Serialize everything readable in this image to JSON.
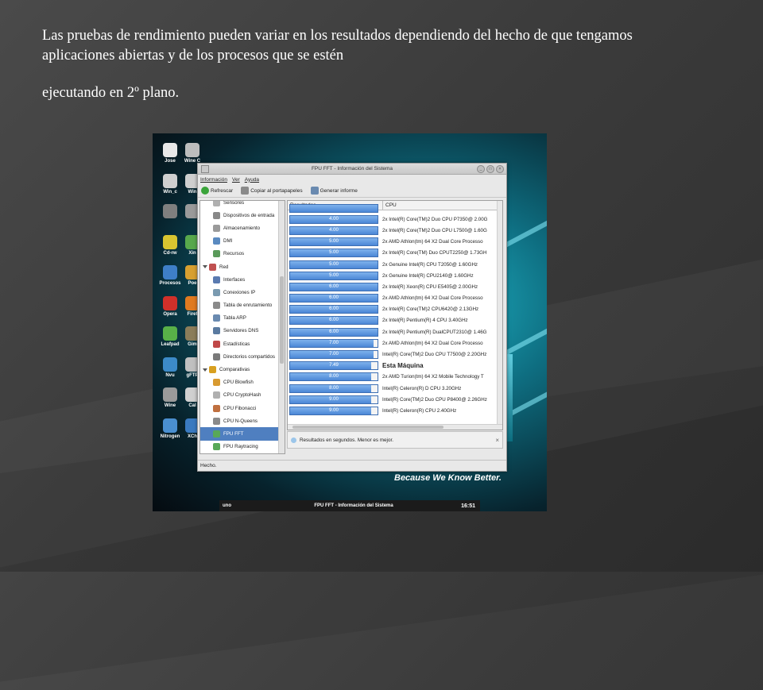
{
  "slide": {
    "paragraph1": "Las pruebas de rendimiento  pueden variar en los resultados dependiendo  del hecho de que tengamos aplicaciones abiertas y de los procesos que se estén",
    "paragraph2": "ejecutando  en 2º plano."
  },
  "desktop": {
    "icons": [
      {
        "label": "Jose",
        "color": "#e8e8e8"
      },
      {
        "label": "Wine C",
        "color": "#bdbdbd"
      },
      {
        "label": "Win_c",
        "color": "#cfcfcf"
      },
      {
        "label": "Win",
        "color": "#cfcfcf"
      },
      {
        "label": "",
        "color": "#7f7f7f"
      },
      {
        "label": "",
        "color": "#9a9a9a"
      },
      {
        "label": "Cd-rw",
        "color": "#d9c530"
      },
      {
        "label": "Xin",
        "color": "#58a84c"
      },
      {
        "label": "Procesos",
        "color": "#3e7fc7"
      },
      {
        "label": "Poe",
        "color": "#d8a030"
      },
      {
        "label": "Opera",
        "color": "#d0302a"
      },
      {
        "label": "Firef",
        "color": "#e07a20"
      },
      {
        "label": "Leafpad",
        "color": "#58b048"
      },
      {
        "label": "Gim",
        "color": "#8b7d5a"
      },
      {
        "label": "Nvu",
        "color": "#3c8ac8"
      },
      {
        "label": "gFTP",
        "color": "#c0c0c0"
      },
      {
        "label": "Wine",
        "color": "#9a9a9a"
      },
      {
        "label": "Cal",
        "color": "#d0d0d0"
      },
      {
        "label": "Nitrogen",
        "color": "#4a8fd0"
      },
      {
        "label": "XCh",
        "color": "#3a7ac0"
      }
    ],
    "slogan": "Because We Know Better.",
    "taskbar": {
      "left": "uno",
      "middle": "FPU FFT - Información del Sistema",
      "time": "16:51"
    }
  },
  "window": {
    "title": "FPU FFT - Información del Sistema",
    "controls": [
      "_",
      "□",
      "×"
    ],
    "menu": [
      "Información",
      "Ver",
      "Ayuda"
    ],
    "toolbar": [
      {
        "label": "Refrescar",
        "icon": "refresh-icon",
        "color": "#3aa43a"
      },
      {
        "label": "Copiar al portapapeles",
        "icon": "copy-icon",
        "color": "#8a8a8a"
      },
      {
        "label": "Generar informe",
        "icon": "report-icon",
        "color": "#6a8ab0"
      }
    ],
    "tree": [
      {
        "label": "Sensores",
        "level": 1,
        "color": "#b0b0b0"
      },
      {
        "label": "Dispositivos de entrada",
        "level": 1,
        "color": "#888888"
      },
      {
        "label": "Almacenamiento",
        "level": 1,
        "color": "#9a9a9a"
      },
      {
        "label": "DMI",
        "level": 1,
        "color": "#5a8ac0"
      },
      {
        "label": "Recursos",
        "level": 1,
        "color": "#5a9a5a"
      },
      {
        "label": "Red",
        "level": 0,
        "color": "#c05050"
      },
      {
        "label": "Interfaces",
        "level": 1,
        "color": "#5a7ab0"
      },
      {
        "label": "Conexiones IP",
        "level": 1,
        "color": "#7a9ab0"
      },
      {
        "label": "Tabla de enrutamiento",
        "level": 1,
        "color": "#8a8a8a"
      },
      {
        "label": "Tabla ARP",
        "level": 1,
        "color": "#6a8ab0"
      },
      {
        "label": "Servidores DNS",
        "level": 1,
        "color": "#5a7aa0"
      },
      {
        "label": "Estadísticas",
        "level": 1,
        "color": "#c04848"
      },
      {
        "label": "Directorios compartidos",
        "level": 1,
        "color": "#7a7a7a"
      },
      {
        "label": "Comparativas",
        "level": 0,
        "color": "#d8a020"
      },
      {
        "label": "CPU Blowfish",
        "level": 1,
        "color": "#d89a30"
      },
      {
        "label": "CPU CryptoHash",
        "level": 1,
        "color": "#b0b0b0"
      },
      {
        "label": "CPU Fibonacci",
        "level": 1,
        "color": "#c07040"
      },
      {
        "label": "CPU N-Queens",
        "level": 1,
        "color": "#8a8a8a"
      },
      {
        "label": "FPU FFT",
        "level": 1,
        "color": "#58a858",
        "selected": true
      },
      {
        "label": "FPU Raytracing",
        "level": 1,
        "color": "#58a858"
      }
    ],
    "table": {
      "headers": [
        "Resultados",
        "CPU"
      ],
      "rows": [
        {
          "value": "",
          "fill": 1.0,
          "cpu": ""
        },
        {
          "value": "4.00",
          "fill": 1.0,
          "cpu": "2x Intel(R) Core(TM)2 Duo CPU P7350@ 2.00G"
        },
        {
          "value": "4.00",
          "fill": 1.0,
          "cpu": "2x Intel(R) Core(TM)2 Duo CPU L7500@ 1.60G"
        },
        {
          "value": "5.00",
          "fill": 1.0,
          "cpu": "2x AMD Athlon(tm) 64 X2 Dual Core Processo"
        },
        {
          "value": "5.00",
          "fill": 1.0,
          "cpu": "2x Intel(R) Core(TM) Duo CPUT2250@ 1.73GH"
        },
        {
          "value": "5.00",
          "fill": 1.0,
          "cpu": "2x Genuine Intel(R) CPU T2050@ 1.60GHz"
        },
        {
          "value": "5.00",
          "fill": 1.0,
          "cpu": "2x Genuine Intel(R) CPU2140@ 1.60GHz"
        },
        {
          "value": "6.00",
          "fill": 1.0,
          "cpu": "2x Intel(R) Xeon(R) CPU E5405@ 2.00GHz"
        },
        {
          "value": "6.00",
          "fill": 1.0,
          "cpu": "2x AMD Athlon(tm) 64 X2 Dual Core Processo"
        },
        {
          "value": "6.00",
          "fill": 1.0,
          "cpu": "2x Intel(R) Core(TM)2 CPU6420@ 2.13GHz"
        },
        {
          "value": "6.00",
          "fill": 1.0,
          "cpu": "2x Intel(R) Pentium(R) 4 CPU 3.40GHz"
        },
        {
          "value": "6.00",
          "fill": 1.0,
          "cpu": "2x Intel(R) Pentium(R) DualCPUT2310@ 1.46G"
        },
        {
          "value": "7.00",
          "fill": 0.95,
          "cpu": "2x AMD Athlon(tm) 64 X2 Dual Core Processo"
        },
        {
          "value": "7.00",
          "fill": 0.95,
          "cpu": "Intel(R) Core(TM)2 Duo CPU T7500@ 2.20GHz"
        },
        {
          "value": "7.49",
          "fill": 0.93,
          "cpu": "Esta Máquina",
          "mine": true
        },
        {
          "value": "8.00",
          "fill": 0.93,
          "cpu": "2x AMD Turion(tm) 64 X2 Mobile Technology T"
        },
        {
          "value": "8.00",
          "fill": 0.93,
          "cpu": "Intel(R) Celeron(R) D CPU 3.20GHz"
        },
        {
          "value": "9.00",
          "fill": 0.93,
          "cpu": "Intel(R) Core(TM)2 Duo CPU P8400@ 2.26GHz"
        },
        {
          "value": "9.00",
          "fill": 0.93,
          "cpu": "Intel(R) Celeron(R) CPU 2.40GHz"
        }
      ]
    },
    "hint": "Resultados en segundos. Menor es mejor.",
    "hint_close": "×",
    "status": "Hecho."
  }
}
